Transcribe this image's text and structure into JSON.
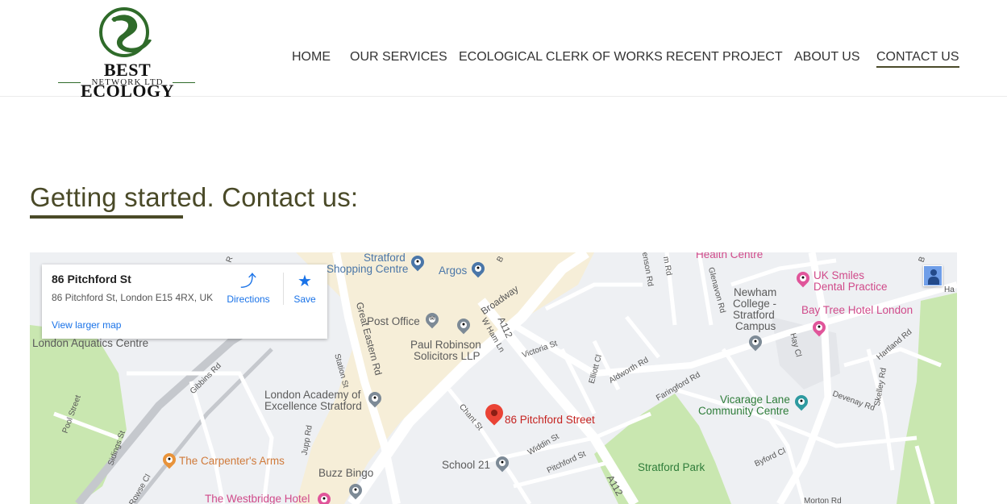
{
  "brand": {
    "name_line1": "BEST ECOLOGY",
    "name_line2": "NETWORK LTD",
    "colors": {
      "logo_green": "#2f6b2a",
      "heading": "#4a4a28"
    }
  },
  "nav": {
    "items": [
      {
        "label": "HOME",
        "active": false
      },
      {
        "label": "OUR SERVICES",
        "active": false
      },
      {
        "label": "ECOLOGICAL CLERK OF WORKS",
        "active": false
      },
      {
        "label": "RECENT PROJECT",
        "active": false
      },
      {
        "label": "ABOUT US",
        "active": false
      },
      {
        "label": "CONTACT US",
        "active": true
      }
    ]
  },
  "page": {
    "heading": "Getting started. Contact us:"
  },
  "map": {
    "infocard": {
      "title": "86 Pitchford St",
      "address": "86 Pitchford St, London E15 4RX, UK",
      "directions_label": "Directions",
      "save_label": "Save",
      "larger_map_label": "View larger map"
    },
    "marker_label": "86 Pitchford Street",
    "places": {
      "stratford": "Stratford",
      "shopping_centre": "Shopping Centre",
      "argos": "Argos",
      "post_office": "Post Office",
      "paul_robinson_1": "Paul Robinson",
      "paul_robinson_2": "Solicitors LLP",
      "london_academy_1": "London Academy of",
      "london_academy_2": "Excellence Stratford",
      "aquatics": "London Aquatics Centre",
      "carpenters": "The Carpenter's Arms",
      "buzz_bingo": "Buzz Bingo",
      "westbridge": "The Westbridge Hotel",
      "school21": "School 21",
      "stratford_park": "Stratford Park",
      "vicarage_1": "Vicarage Lane",
      "vicarage_2": "Community Centre",
      "newham_1": "Newham",
      "newham_2": "College -",
      "newham_3": "Stratford",
      "newham_4": "Campus",
      "uk_smiles_1": "UK Smiles",
      "uk_smiles_2": "Dental Practice",
      "bay_tree": "Bay Tree Hotel London",
      "health_centre": "Health Centre"
    },
    "streets": {
      "broadway": "Broadway",
      "a112_1": "A112",
      "a112_2": "A112",
      "great_eastern": "Great Eastern Rd",
      "w_ham_ln": "W Ham Ln",
      "victoria": "Victoria St",
      "station": "Station St",
      "gibbins": "Gibbins Rd",
      "pool": "Pool Street",
      "sidings": "Sidings St",
      "jupp": "Jupp Rd",
      "rowse": "Rowse Cl",
      "chant": "Chant St",
      "widdin": "Widdin St",
      "pitchford": "Pitchford St",
      "elliott": "Elliott Cl",
      "aldworth": "Aldworth Rd",
      "faringford": "Faringford Rd",
      "devenay": "Devenay Rd",
      "byford": "Byford Cl",
      "hay": "Hay Cl",
      "hartland": "Hartland Rd",
      "skelley": "Skelley Rd",
      "glenavon": "Glenavon Rd",
      "enson": "enson Rd",
      "m_rd": "m Rd",
      "morton": "Morton Rd",
      "ha": "Ha",
      "b": "B",
      "r": "R",
      "b2": "B"
    }
  }
}
